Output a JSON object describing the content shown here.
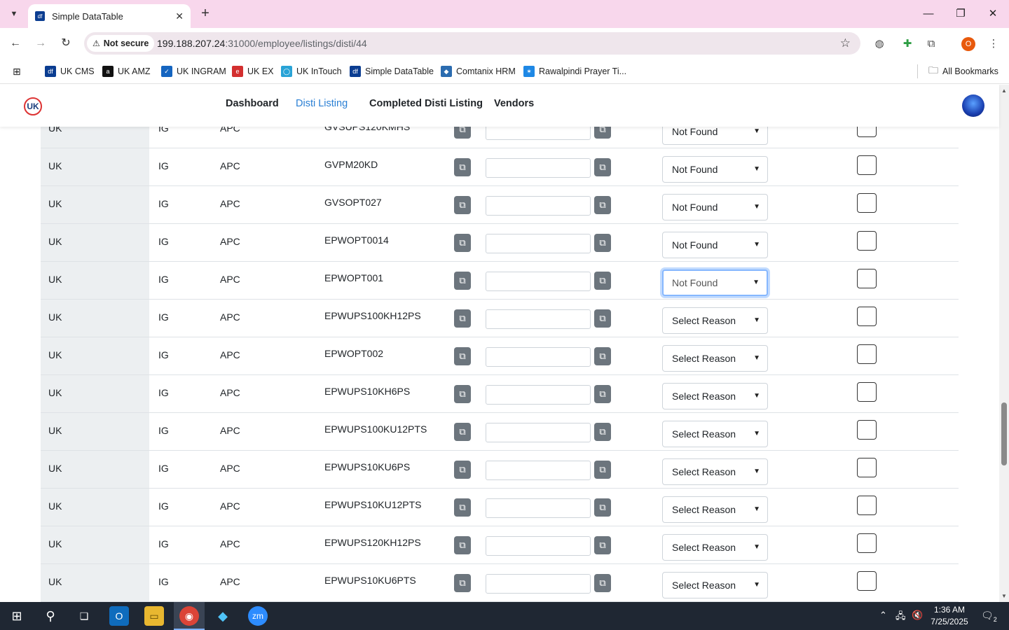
{
  "browser": {
    "tab_title": "Simple DataTable",
    "tab_favicon": "df",
    "security_label": "Not secure",
    "url_host": "199.188.207.24",
    "url_rest": ":31000/employee/listings/disti/44",
    "profile_initial": "O",
    "bookmarks": [
      {
        "label": "UK CMS",
        "icon": "df",
        "color": "#0b3d91"
      },
      {
        "label": "UK AMZ",
        "icon": "a",
        "color": "#111111"
      },
      {
        "label": "UK INGRAM",
        "icon": "✓",
        "color": "#1565c0"
      },
      {
        "label": "UK EX",
        "icon": "e",
        "color": "#d32f2f"
      },
      {
        "label": "UK InTouch",
        "icon": "◯",
        "color": "#29a3d6"
      },
      {
        "label": "Simple DataTable",
        "icon": "df",
        "color": "#0b3d91"
      },
      {
        "label": "Comtanix HRM",
        "icon": "◆",
        "color": "#2b6cb0"
      },
      {
        "label": "Rawalpindi Prayer Ti...",
        "icon": "✶",
        "color": "#1e88e5"
      }
    ],
    "all_bookmarks": "All Bookmarks"
  },
  "app": {
    "nav": [
      {
        "label": "Dashboard"
      },
      {
        "label": "Disti Listing"
      },
      {
        "label": "Completed Disti Listing"
      },
      {
        "label": "Vendors"
      }
    ]
  },
  "table": {
    "rows": [
      {
        "country": "UK",
        "disti": "IG",
        "brand": "APC",
        "sku": "GVSUPS120KMHS",
        "reason": "Not Found"
      },
      {
        "country": "UK",
        "disti": "IG",
        "brand": "APC",
        "sku": "GVPM20KD",
        "reason": "Not Found"
      },
      {
        "country": "UK",
        "disti": "IG",
        "brand": "APC",
        "sku": "GVSOPT027",
        "reason": "Not Found"
      },
      {
        "country": "UK",
        "disti": "IG",
        "brand": "APC",
        "sku": "EPWOPT0014",
        "reason": "Not Found"
      },
      {
        "country": "UK",
        "disti": "IG",
        "brand": "APC",
        "sku": "EPWOPT001",
        "reason": "Not Found"
      },
      {
        "country": "UK",
        "disti": "IG",
        "brand": "APC",
        "sku": "EPWUPS100KH12PS",
        "reason": "Select Reason"
      },
      {
        "country": "UK",
        "disti": "IG",
        "brand": "APC",
        "sku": "EPWOPT002",
        "reason": "Select Reason"
      },
      {
        "country": "UK",
        "disti": "IG",
        "brand": "APC",
        "sku": "EPWUPS10KH6PS",
        "reason": "Select Reason"
      },
      {
        "country": "UK",
        "disti": "IG",
        "brand": "APC",
        "sku": "EPWUPS100KU12PTS",
        "reason": "Select Reason"
      },
      {
        "country": "UK",
        "disti": "IG",
        "brand": "APC",
        "sku": "EPWUPS10KU6PS",
        "reason": "Select Reason"
      },
      {
        "country": "UK",
        "disti": "IG",
        "brand": "APC",
        "sku": "EPWUPS10KU12PTS",
        "reason": "Select Reason"
      },
      {
        "country": "UK",
        "disti": "IG",
        "brand": "APC",
        "sku": "EPWUPS120KH12PS",
        "reason": "Select Reason"
      },
      {
        "country": "UK",
        "disti": "IG",
        "brand": "APC",
        "sku": "EPWUPS10KU6PTS",
        "reason": "Select Reason"
      }
    ]
  },
  "taskbar": {
    "time": "1:36 AM",
    "date": "7/25/2025",
    "notifications": "2"
  },
  "colors": {
    "tabbar": "#f8d7ec",
    "nav_active": "#2a7fd4",
    "copy_button": "#6c757d"
  }
}
